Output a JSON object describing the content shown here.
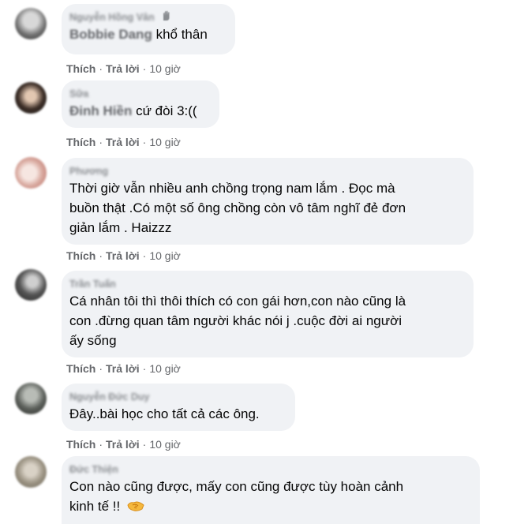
{
  "colors": {
    "bubble": "#f0f2f5",
    "meta": "#65676b",
    "text": "#050505"
  },
  "comments": [
    {
      "author": "Nguyễn Hồng Vân",
      "tag": "Bobbie Dang",
      "text": "khổ thân",
      "actions": {
        "like": "Thích",
        "reply": "Trả lời",
        "time": "10 giờ"
      }
    },
    {
      "author": "Sữa",
      "tag": "Đinh Hiền",
      "text": "cứ đòi 3:((",
      "actions": {
        "like": "Thích",
        "reply": "Trả lời",
        "time": "10 giờ"
      }
    },
    {
      "author": "Phương",
      "lines": [
        "Thời giờ vẫn nhiều anh chồng trọng nam lắm . Đọc mà",
        "buồn thật .Có một số ông chồng còn vô tâm nghĩ đẻ đơn",
        "giản lắm . Haizzz"
      ],
      "actions": {
        "like": "Thích",
        "reply": "Trả lời",
        "time": "10 giờ"
      }
    },
    {
      "author": "Trần Tuấn",
      "lines": [
        "Cá nhân tôi thì thôi thích có con gái hơn,con nào cũng là",
        "con .đừng quan tâm người khác nói j .cuộc đời ai người",
        "ấy sống"
      ],
      "actions": {
        "like": "Thích",
        "reply": "Trả lời",
        "time": "10 giờ"
      }
    },
    {
      "author": "Nguyễn Đức Duy",
      "lines": [
        "Đây..bài học cho tất cả các ông."
      ],
      "actions": {
        "like": "Thích",
        "reply": "Trả lời",
        "time": "10 giờ"
      }
    },
    {
      "author": "Đức Thiện",
      "lines": [
        "Con nào cũng được, mấy con cũng được tùy hoàn cảnh",
        "kinh tế !!"
      ],
      "emoji": "handshake-icon"
    }
  ]
}
